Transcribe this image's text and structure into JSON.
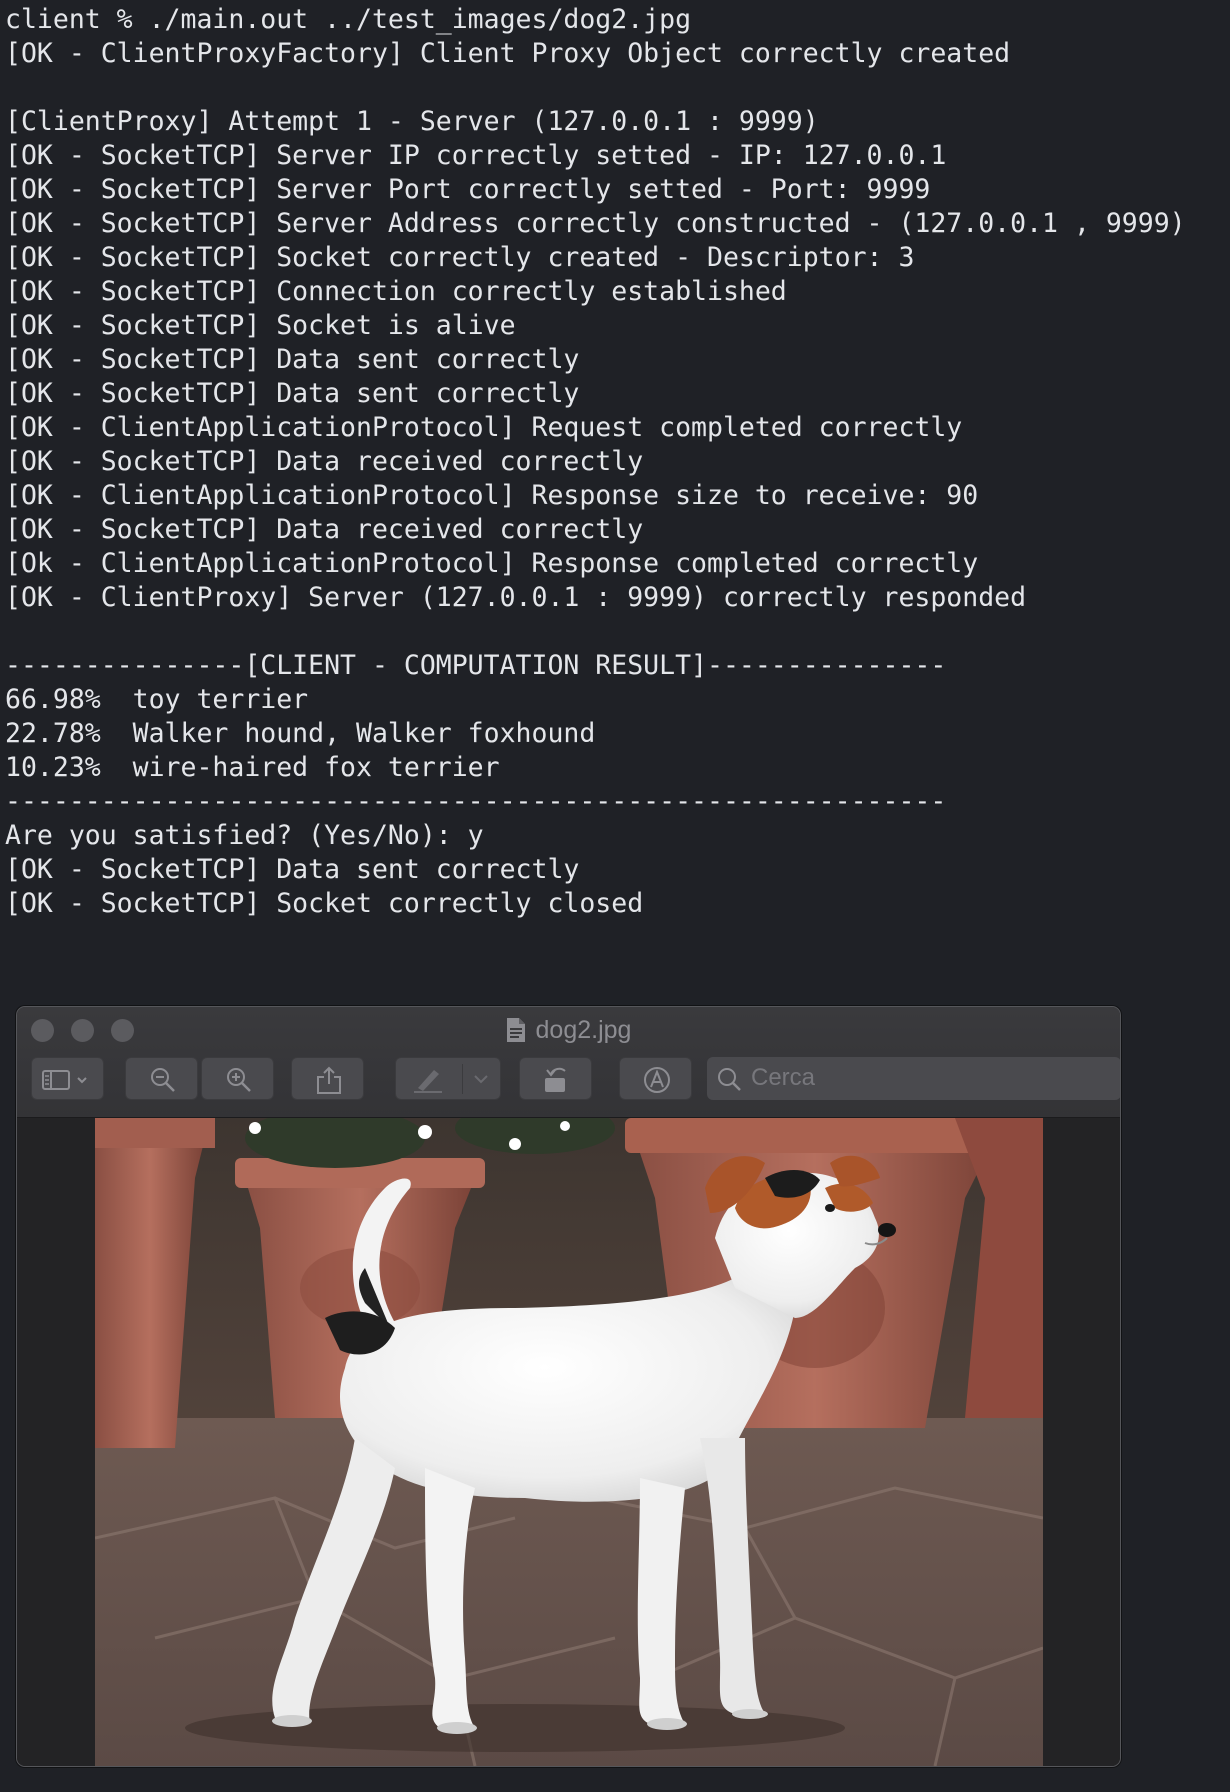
{
  "terminal": {
    "lines": [
      "client % ./main.out ../test_images/dog2.jpg",
      "[OK - ClientProxyFactory] Client Proxy Object correctly created",
      "",
      "[ClientProxy] Attempt 1 - Server (127.0.0.1 : 9999)",
      "[OK - SocketTCP] Server IP correctly setted - IP: 127.0.0.1",
      "[OK - SocketTCP] Server Port correctly setted - Port: 9999",
      "[OK - SocketTCP] Server Address correctly constructed - (127.0.0.1 , 9999)",
      "[OK - SocketTCP] Socket correctly created - Descriptor: 3",
      "[OK - SocketTCP] Connection correctly established",
      "[OK - SocketTCP] Socket is alive",
      "[OK - SocketTCP] Data sent correctly",
      "[OK - SocketTCP] Data sent correctly",
      "[OK - ClientApplicationProtocol] Request completed correctly",
      "[OK - SocketTCP] Data received correctly",
      "[OK - ClientApplicationProtocol] Response size to receive: 90",
      "[OK - SocketTCP] Data received correctly",
      "[Ok - ClientApplicationProtocol] Response completed correctly",
      "[OK - ClientProxy] Server (127.0.0.1 : 9999) correctly responded",
      "",
      "---------------[CLIENT - COMPUTATION RESULT]---------------",
      "66.98%  toy terrier",
      "22.78%  Walker hound, Walker foxhound",
      "10.23%  wire-haired fox terrier",
      "-----------------------------------------------------------",
      "Are you satisfied? (Yes/No): y",
      "[OK - SocketTCP] Data sent correctly",
      "[OK - SocketTCP] Socket correctly closed"
    ]
  },
  "preview": {
    "title": "dog2.jpg",
    "search_placeholder": "Cerca",
    "icons": {
      "file": "document-icon",
      "sidebar": "sidebar-toggle-icon",
      "zoom_out": "zoom-out-icon",
      "zoom_in": "zoom-in-icon",
      "share": "share-icon",
      "markup": "markup-pen-icon",
      "rotate": "rotate-icon",
      "annotate": "annotate-icon",
      "search": "search-icon"
    }
  },
  "colors": {
    "terminal_bg": "#1f2126",
    "terminal_text": "#e4e6ea",
    "window_chrome": "#3a3a3d",
    "toolbar_button": "#4a4a4e"
  }
}
